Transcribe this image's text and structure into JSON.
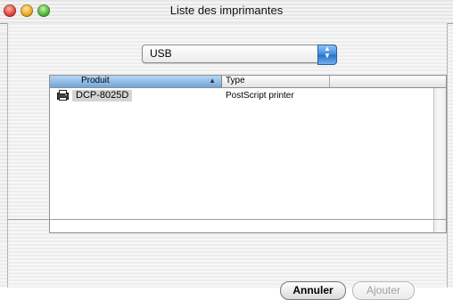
{
  "window": {
    "title": "Liste des imprimantes"
  },
  "connection": {
    "selected": "USB"
  },
  "table": {
    "columns": [
      "Produit",
      "Type"
    ],
    "rows": [
      {
        "name": "DCP-8025D",
        "type": "PostScript printer"
      }
    ]
  },
  "buttons": {
    "cancel": "Annuler",
    "add": "Ajouter"
  },
  "icons": {
    "close": "close-icon",
    "minimize": "minimize-icon",
    "zoom": "zoom-icon",
    "sort": "sort-ascending-icon",
    "printer": "printer-icon",
    "popup": "updown-arrows-icon"
  },
  "colors": {
    "selection": "#d4d4d4",
    "header_active": "#8fbbe6",
    "popup_accent": "#3b8ae0"
  }
}
